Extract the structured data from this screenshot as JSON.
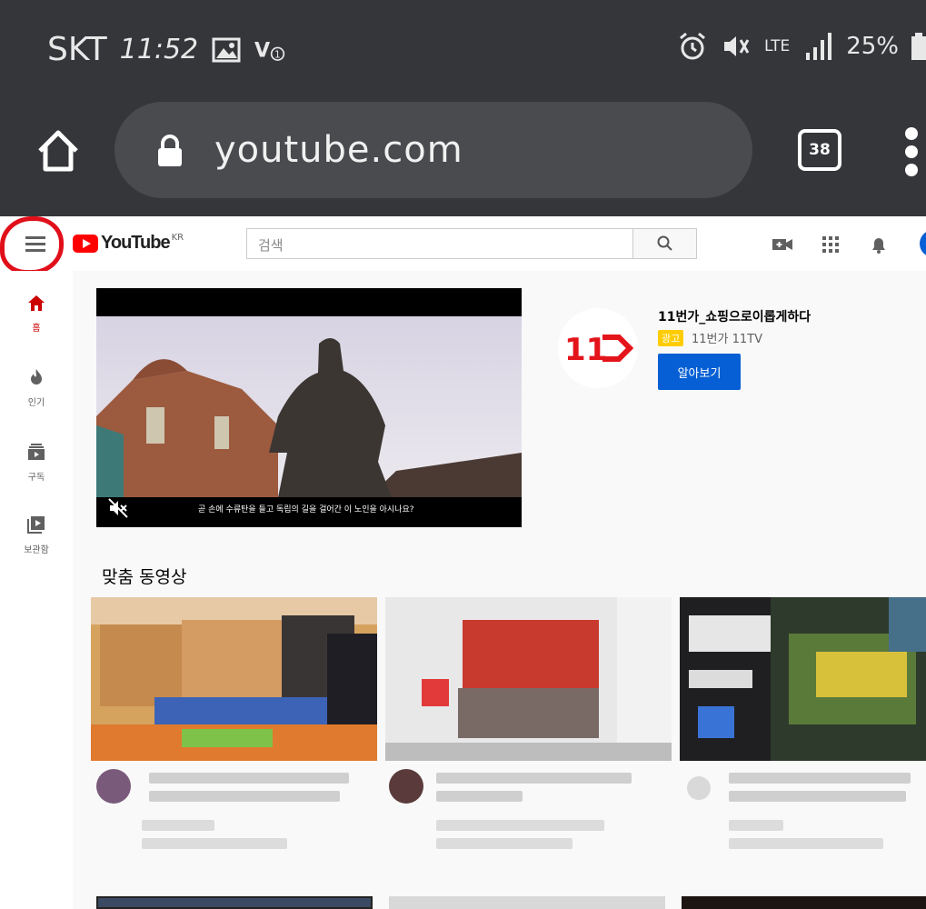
{
  "status_bar": {
    "carrier": "SKT",
    "time": "11:52",
    "network": "LTE",
    "battery": "25%"
  },
  "browser": {
    "url": "youtube.com",
    "tab_count": "38"
  },
  "youtube": {
    "logo_text": "YouTube",
    "region": "KR",
    "search_placeholder": "검색"
  },
  "sidebar": {
    "items": [
      {
        "label": "홈",
        "icon": "home-icon",
        "active": true
      },
      {
        "label": "인기",
        "icon": "trending-icon",
        "active": false
      },
      {
        "label": "구독",
        "icon": "subscriptions-icon",
        "active": false
      },
      {
        "label": "보관함",
        "icon": "library-icon",
        "active": false
      }
    ]
  },
  "ad": {
    "caption": "곧 손에 수류탄을 들고 독립의 길을 걸어간 이 노인을 아시나요?",
    "logo_text": "11",
    "title": "11번가_쇼핑으로이롭게하다",
    "badge": "광고",
    "channel": "11번가 11TV",
    "cta": "알아보기"
  },
  "section": {
    "title": "맞춤 동영상"
  },
  "colors": {
    "status_bg": "#35363a",
    "yt_red": "#ff0000",
    "accent_blue": "#065fd4",
    "annotation_red": "#e10f1a"
  }
}
